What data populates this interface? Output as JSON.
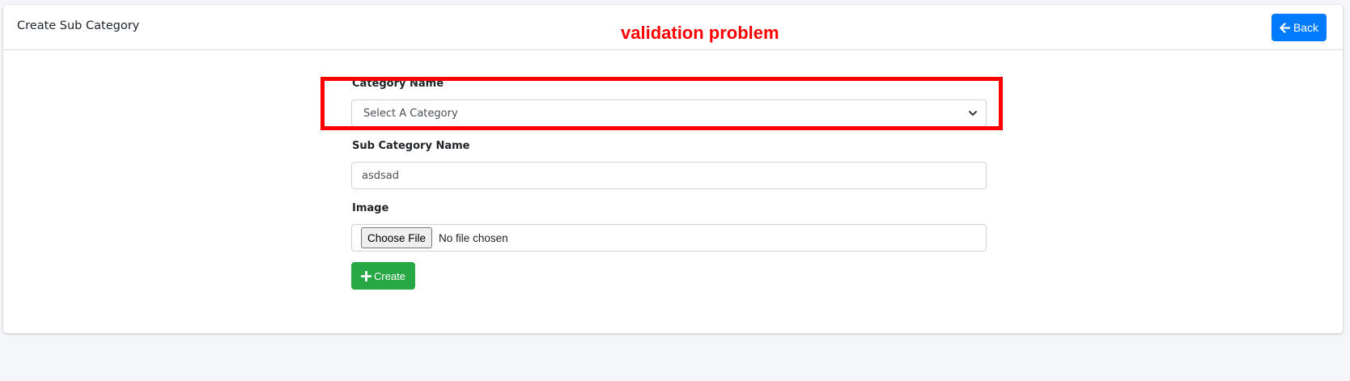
{
  "header": {
    "title": "Create Sub Category",
    "back_label": "Back"
  },
  "annotation": {
    "text": "validation problem",
    "color": "#ff0000"
  },
  "form": {
    "category": {
      "label": "Category Name",
      "selected": "Select A Category"
    },
    "sub_category": {
      "label": "Sub Category Name",
      "value": "asdsad"
    },
    "image": {
      "label": "Image",
      "button_label": "Choose File",
      "status": "No file chosen"
    },
    "submit_label": "Create"
  },
  "colors": {
    "primary": "#007bff",
    "success": "#28a745",
    "background": "#f4f6f9"
  },
  "icons": {
    "back": "arrow-left-icon",
    "create": "plus-icon",
    "select": "chevron-down-icon"
  }
}
